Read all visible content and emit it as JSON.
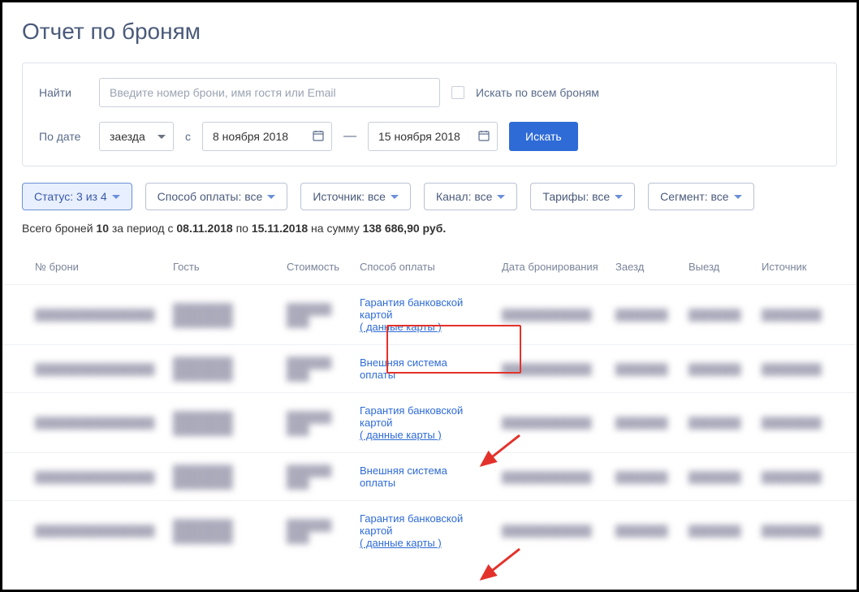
{
  "page": {
    "title": "Отчет по броням"
  },
  "search": {
    "find_label": "Найти",
    "placeholder": "Введите номер брони, имя гостя или Email",
    "all_bookings_label": "Искать по всем броням",
    "by_date_label": "По дате",
    "date_type": "заезда",
    "from_label": "с",
    "date_from": "8 ноября 2018",
    "dash": "—",
    "date_to": "15 ноября 2018",
    "search_button": "Искать"
  },
  "filters": {
    "status": "Статус: 3 из 4",
    "payment": "Способ оплаты: все",
    "source": "Источник: все",
    "channel": "Канал: все",
    "tariffs": "Тарифы: все",
    "segment": "Сегмент: все"
  },
  "summary": {
    "prefix": "Всего броней ",
    "count": "10",
    "period_prefix": " за период с ",
    "date_from": "08.11.2018",
    "period_mid": " по ",
    "date_to": "15.11.2018",
    "sum_prefix": " на сумму ",
    "sum": "138 686,90 руб."
  },
  "table": {
    "headers": {
      "number": "№ брони",
      "guest": "Гость",
      "cost": "Стоимость",
      "payment": "Способ оплаты",
      "booking_date": "Дата бронирования",
      "checkin": "Заезд",
      "checkout": "Выезд",
      "source": "Источник"
    },
    "rows": [
      {
        "payment_text": "Гарантия банковской картой",
        "payment_link": "( данные карты )"
      },
      {
        "payment_text": "Внешняя система оплаты",
        "payment_link": ""
      },
      {
        "payment_text": "Гарантия банковской картой",
        "payment_link": "( данные карты )"
      },
      {
        "payment_text": "Внешняя система оплаты",
        "payment_link": ""
      },
      {
        "payment_text": "Гарантия банковской картой",
        "payment_link": "( данные карты )"
      }
    ]
  }
}
